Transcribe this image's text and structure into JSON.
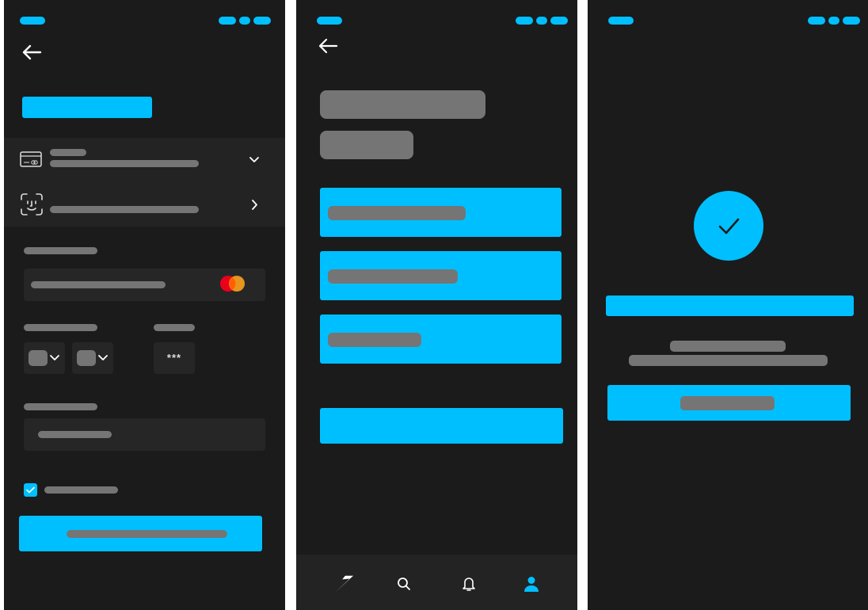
{
  "colors": {
    "accent": "#00bfff",
    "background": "#1b1b1c",
    "surface": "#232324",
    "placeholder": "#757575",
    "mastercard_red": "#eb001b",
    "mastercard_orange": "#f79e1b"
  },
  "payment_screen": {
    "icons": {
      "back": "arrow-left-icon",
      "card": "credit-card-icon",
      "face": "face-id-icon",
      "expand": "chevron-down-icon",
      "navigate": "chevron-right-icon",
      "brand": "mastercard-logo-icon"
    },
    "cvv_value": "***",
    "remember_checked": true
  },
  "options_screen": {
    "icons": {
      "back": "arrow-left-icon"
    },
    "tabbar": [
      {
        "name": "home",
        "icon": "swoosh-logo-icon",
        "active": false
      },
      {
        "name": "search",
        "icon": "search-icon",
        "active": false
      },
      {
        "name": "notifications",
        "icon": "bell-icon",
        "active": false
      },
      {
        "name": "profile",
        "icon": "user-icon",
        "active": true
      }
    ]
  },
  "success_screen": {
    "icons": {
      "success": "check-icon"
    }
  }
}
